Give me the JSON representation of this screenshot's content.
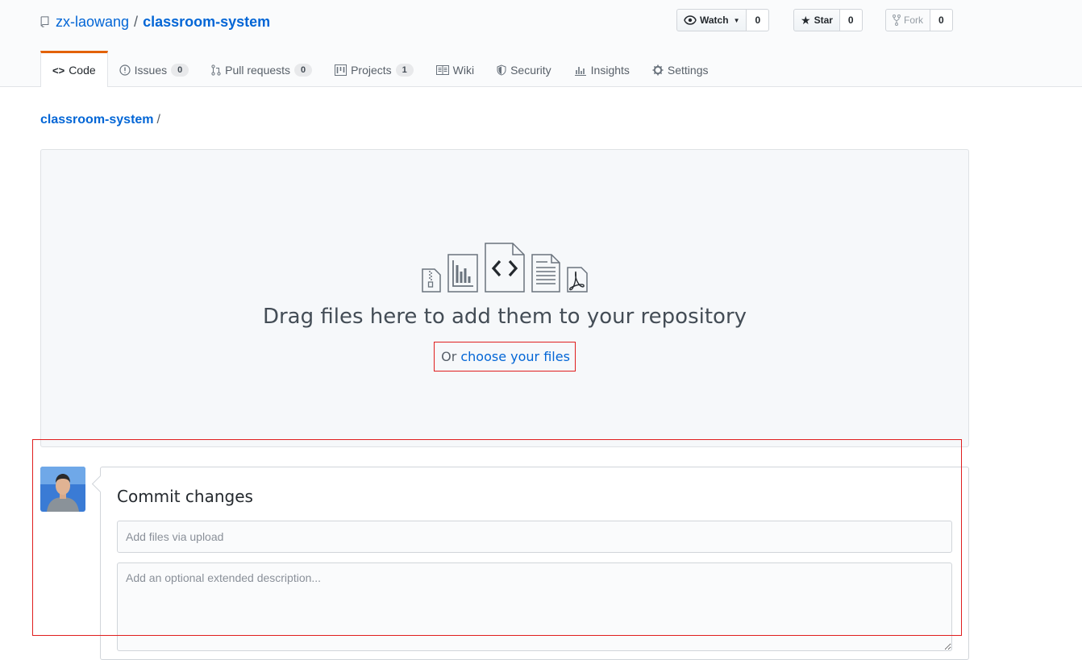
{
  "repo": {
    "owner": "zx-laowang",
    "separator": "/",
    "name": "classroom-system"
  },
  "actions": {
    "watch": {
      "label": "Watch",
      "count": "0"
    },
    "star": {
      "label": "Star",
      "count": "0"
    },
    "fork": {
      "label": "Fork",
      "count": "0"
    }
  },
  "tabs": [
    {
      "label": "Code",
      "icon": "code-icon"
    },
    {
      "label": "Issues",
      "count": "0",
      "icon": "issue-icon"
    },
    {
      "label": "Pull requests",
      "count": "0",
      "icon": "pull-request-icon"
    },
    {
      "label": "Projects",
      "count": "1",
      "icon": "project-icon"
    },
    {
      "label": "Wiki",
      "icon": "book-icon"
    },
    {
      "label": "Security",
      "icon": "shield-icon"
    },
    {
      "label": "Insights",
      "icon": "graph-icon"
    },
    {
      "label": "Settings",
      "icon": "gear-icon"
    }
  ],
  "breadcrumb": {
    "repo": "classroom-system",
    "separator": "/"
  },
  "upload": {
    "heading": "Drag files here to add them to your repository",
    "or_text": "Or",
    "choose_link": "choose your files"
  },
  "commit": {
    "title": "Commit changes",
    "summary_placeholder": "Add files via upload",
    "description_placeholder": "Add an optional extended description..."
  },
  "colors": {
    "link": "#0366d6",
    "selected_tab_accent": "#e36209",
    "annotation": "#e01e1e"
  }
}
